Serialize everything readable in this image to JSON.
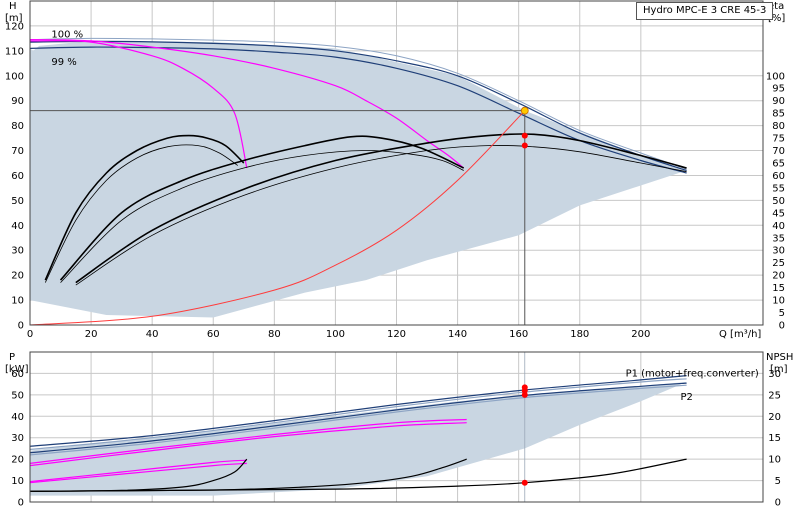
{
  "pump_label": "Hydro MPC-E 3 CRE 45-3",
  "colors": {
    "grid": "#c8c8c8",
    "envelope_fill": "#c9d6e2",
    "curve_dark": "#1f3f78",
    "curve_light": "#8da4c4",
    "magenta": "#ff00ff",
    "system_curve": "#ff3c3c",
    "duty_line": "#555555",
    "duty_dot": "#ff0000",
    "op_point": "#ffc800"
  },
  "chart_data": [
    {
      "type": "line",
      "title": "",
      "xlabel": "Q [m³/h]",
      "ylabel_left": "H [m]",
      "ylabel_right": "eta [%]",
      "xlim": [
        0,
        240
      ],
      "ylim": [
        0,
        130
      ],
      "eta_lim": [
        0,
        130
      ],
      "x_ticks": [
        0,
        20,
        40,
        60,
        80,
        100,
        120,
        140,
        160,
        180,
        200
      ],
      "y_ticks": [
        0,
        10,
        20,
        30,
        40,
        50,
        60,
        70,
        80,
        90,
        100,
        110,
        120
      ],
      "eta_ticks": [
        0,
        5,
        10,
        15,
        20,
        25,
        30,
        35,
        40,
        45,
        50,
        55,
        60,
        65,
        70,
        75,
        80,
        85,
        90,
        95,
        100
      ],
      "annotations": [
        {
          "text": "100 %",
          "x": 7,
          "y": 117
        },
        {
          "text": "99 %",
          "x": 7,
          "y": 106
        }
      ],
      "series": [
        {
          "role": "speed",
          "values": [
            [
              0,
              113.5
            ],
            [
              20,
              113.8
            ],
            [
              40,
              113.6
            ],
            [
              60,
              113
            ],
            [
              80,
              112
            ],
            [
              100,
              110
            ],
            [
              120,
              106
            ],
            [
              140,
              100
            ],
            [
              160,
              89
            ],
            [
              180,
              77
            ],
            [
              200,
              68
            ],
            [
              215,
              62
            ]
          ]
        },
        {
          "role": "speed",
          "values": [
            [
              0,
              114.5
            ],
            [
              20,
              115
            ],
            [
              40,
              114.8
            ],
            [
              60,
              114.3
            ],
            [
              80,
              113.5
            ],
            [
              100,
              111.8
            ],
            [
              120,
              108
            ],
            [
              140,
              101
            ],
            [
              160,
              90
            ],
            [
              180,
              78
            ],
            [
              200,
              69
            ],
            [
              215,
              62.5
            ]
          ]
        },
        {
          "role": "speed",
          "values": [
            [
              0,
              111
            ],
            [
              20,
              111.5
            ],
            [
              40,
              111.3
            ],
            [
              60,
              110.8
            ],
            [
              80,
              109.5
            ],
            [
              100,
              107.5
            ],
            [
              120,
              103
            ],
            [
              140,
              96
            ],
            [
              160,
              85
            ],
            [
              180,
              74
            ],
            [
              200,
              66
            ],
            [
              215,
              61
            ]
          ]
        },
        {
          "role": "min_speed",
          "values": [
            [
              0,
              114
            ],
            [
              20,
              113.5
            ],
            [
              40,
              108
            ],
            [
              50,
              103
            ],
            [
              60,
              95
            ],
            [
              67,
              85
            ],
            [
              71,
              63
            ]
          ]
        },
        {
          "role": "min_speed",
          "values": [
            [
              0,
              114.5
            ],
            [
              20,
              114
            ],
            [
              40,
              111.5
            ],
            [
              60,
              108
            ],
            [
              80,
              103
            ],
            [
              100,
              96
            ],
            [
              110,
              90
            ],
            [
              120,
              83
            ],
            [
              130,
              74
            ],
            [
              137,
              68
            ],
            [
              142,
              63
            ]
          ]
        },
        {
          "role": "efficiency",
          "values": [
            [
              5,
              17
            ],
            [
              15,
              42
            ],
            [
              25,
              58
            ],
            [
              35,
              67
            ],
            [
              45,
              71.5
            ],
            [
              55,
              72
            ],
            [
              62,
              69
            ],
            [
              68,
              64
            ]
          ]
        },
        {
          "role": "efficiency",
          "values": [
            [
              5,
              18
            ],
            [
              15,
              45
            ],
            [
              25,
              61
            ],
            [
              35,
              70
            ],
            [
              45,
              75
            ],
            [
              52,
              76
            ],
            [
              58,
              75
            ],
            [
              64,
              72
            ],
            [
              70,
              65
            ]
          ]
        },
        {
          "role": "efficiency",
          "values": [
            [
              10,
              17
            ],
            [
              30,
              42
            ],
            [
              50,
              55
            ],
            [
              70,
              63
            ],
            [
              90,
              68
            ],
            [
              110,
              70
            ],
            [
              125,
              68.5
            ],
            [
              135,
              66
            ],
            [
              142,
              62
            ]
          ]
        },
        {
          "role": "efficiency",
          "values": [
            [
              10,
              18
            ],
            [
              30,
              45
            ],
            [
              50,
              58
            ],
            [
              70,
              66
            ],
            [
              90,
              72
            ],
            [
              105,
              75.5
            ],
            [
              115,
              75
            ],
            [
              128,
              71
            ],
            [
              142,
              63
            ]
          ]
        },
        {
          "role": "efficiency",
          "values": [
            [
              15,
              16
            ],
            [
              40,
              36
            ],
            [
              70,
              52
            ],
            [
              100,
              63
            ],
            [
              130,
              70
            ],
            [
              150,
              72
            ],
            [
              165,
              71.5
            ],
            [
              180,
              69.5
            ],
            [
              200,
              65
            ],
            [
              215,
              61.5
            ]
          ]
        },
        {
          "role": "efficiency",
          "values": [
            [
              15,
              17
            ],
            [
              40,
              38
            ],
            [
              70,
              54.5
            ],
            [
              100,
              66
            ],
            [
              130,
              73
            ],
            [
              150,
              76
            ],
            [
              165,
              76.5
            ],
            [
              180,
              74
            ],
            [
              200,
              68
            ],
            [
              215,
              63
            ]
          ]
        },
        {
          "role": "system",
          "values": [
            [
              0,
              0
            ],
            [
              40,
              3.5
            ],
            [
              80,
              14
            ],
            [
              100,
              24
            ],
            [
              120,
              38
            ],
            [
              140,
              58
            ],
            [
              162,
              86
            ]
          ]
        }
      ],
      "envelope": [
        [
          0,
          111
        ],
        [
          1,
          110
        ],
        [
          3,
          112
        ],
        [
          20,
          114
        ],
        [
          60,
          113.5
        ],
        [
          100,
          111
        ],
        [
          140,
          100
        ],
        [
          162,
          86
        ],
        [
          200,
          68
        ],
        [
          215,
          62
        ],
        [
          180,
          48
        ],
        [
          160,
          36
        ],
        [
          130,
          26
        ],
        [
          110,
          18
        ],
        [
          90,
          13
        ],
        [
          60,
          3
        ],
        [
          25,
          4
        ],
        [
          0,
          10
        ]
      ],
      "duty_point": {
        "q": 162,
        "h": 86,
        "markers": [
          76,
          72
        ]
      }
    },
    {
      "type": "line",
      "title": "",
      "xlabel": "",
      "ylabel_left": "P [kW]",
      "ylabel_right": "NPSH [m]",
      "xlim": [
        0,
        240
      ],
      "ylim": [
        0,
        70
      ],
      "npsh_lim": [
        0,
        35
      ],
      "y_ticks": [
        0,
        10,
        20,
        30,
        40,
        50,
        60
      ],
      "npsh_ticks": [
        0,
        5,
        10,
        15,
        20,
        25,
        30
      ],
      "labels": [
        {
          "text": "P1 (motor+freq.converter)",
          "x": 195,
          "y": 60.5
        },
        {
          "text": "P2",
          "x": 213,
          "y": 49.5
        }
      ],
      "series": [
        {
          "role": "power",
          "values": [
            [
              0,
              26
            ],
            [
              40,
              31
            ],
            [
              80,
              38
            ],
            [
              120,
              45.5
            ],
            [
              160,
              52
            ],
            [
              200,
              57
            ],
            [
              215,
              59
            ]
          ]
        },
        {
          "role": "power",
          "values": [
            [
              0,
              24.5
            ],
            [
              40,
              30
            ],
            [
              80,
              37
            ],
            [
              120,
              44.5
            ],
            [
              160,
              51
            ],
            [
              200,
              56
            ],
            [
              215,
              57.5
            ]
          ]
        },
        {
          "role": "power",
          "values": [
            [
              0,
              23
            ],
            [
              40,
              28.5
            ],
            [
              80,
              35.5
            ],
            [
              120,
              43
            ],
            [
              160,
              49.5
            ],
            [
              200,
              54
            ],
            [
              215,
              55.5
            ]
          ]
        },
        {
          "role": "power",
          "values": [
            [
              0,
              22
            ],
            [
              40,
              27.5
            ],
            [
              80,
              34.5
            ],
            [
              120,
              42
            ],
            [
              160,
              48.5
            ],
            [
              200,
              53
            ],
            [
              215,
              54.5
            ]
          ]
        },
        {
          "role": "power_min",
          "values": [
            [
              0,
              18
            ],
            [
              40,
              25
            ],
            [
              80,
              31.5
            ],
            [
              120,
              37
            ],
            [
              143,
              38.5
            ]
          ]
        },
        {
          "role": "power_min",
          "values": [
            [
              0,
              17
            ],
            [
              40,
              24
            ],
            [
              80,
              30.5
            ],
            [
              120,
              35.5
            ],
            [
              143,
              37
            ]
          ]
        },
        {
          "role": "power_min",
          "values": [
            [
              0,
              9.5
            ],
            [
              30,
              14
            ],
            [
              60,
              18.5
            ],
            [
              71,
              19.5
            ]
          ]
        },
        {
          "role": "power_min",
          "values": [
            [
              0,
              9
            ],
            [
              30,
              13
            ],
            [
              60,
              17
            ],
            [
              71,
              18
            ]
          ]
        },
        {
          "role": "npsh",
          "values": [
            [
              0,
              2.5
            ],
            [
              30,
              2.7
            ],
            [
              50,
              3.5
            ],
            [
              60,
              5
            ],
            [
              67,
              7
            ],
            [
              71,
              10
            ]
          ]
        },
        {
          "role": "npsh",
          "values": [
            [
              0,
              2.5
            ],
            [
              60,
              2.8
            ],
            [
              90,
              3.5
            ],
            [
              110,
              4.5
            ],
            [
              125,
              6
            ],
            [
              135,
              8
            ],
            [
              143,
              10
            ]
          ]
        },
        {
          "role": "npsh",
          "values": [
            [
              0,
              2.5
            ],
            [
              100,
              3
            ],
            [
              140,
              3.7
            ],
            [
              162,
              4.5
            ],
            [
              190,
              6.5
            ],
            [
              215,
              10
            ]
          ]
        }
      ],
      "envelope": [
        [
          0,
          24
        ],
        [
          70,
          35
        ],
        [
          140,
          47
        ],
        [
          215,
          56
        ],
        [
          200,
          47
        ],
        [
          180,
          36
        ],
        [
          162,
          25
        ],
        [
          130,
          12
        ],
        [
          100,
          6
        ],
        [
          60,
          3
        ],
        [
          0,
          3
        ]
      ],
      "duty_markers": {
        "q": 162,
        "p": [
          53.5,
          52,
          50
        ],
        "npsh": 4.5
      }
    }
  ]
}
